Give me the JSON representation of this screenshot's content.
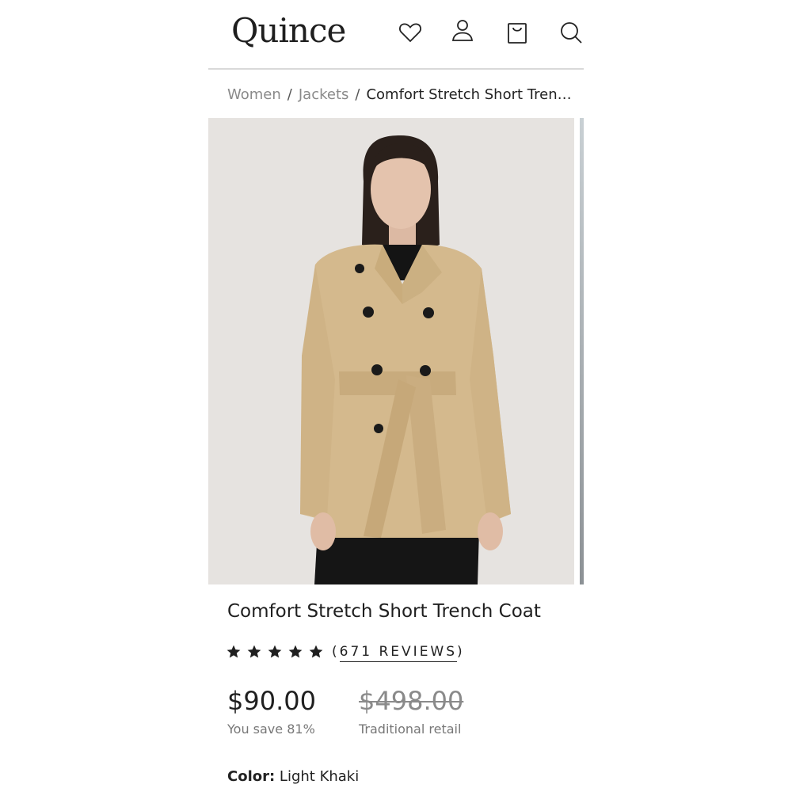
{
  "header": {
    "logo": "Quince",
    "icons": [
      "heart-icon",
      "account-icon",
      "bag-icon",
      "search-icon"
    ]
  },
  "breadcrumb": {
    "items": [
      "Women",
      "Jackets"
    ],
    "current": "Comfort Stretch Short Trench Coat"
  },
  "product": {
    "title": "Comfort Stretch Short Trench Coat",
    "rating": 5,
    "reviews_open": "(",
    "reviews_text": "671 REVIEWS",
    "reviews_close": ")",
    "price": "$90.00",
    "savings": "You save 81%",
    "retail_price": "$498.00",
    "retail_label": "Traditional retail",
    "color_label": "Color:",
    "color_value": "Light Khaki"
  },
  "colors": {
    "text": "#222222",
    "muted": "#8a8a8a",
    "image_bg": "#e6e3e0",
    "coat": "#d4b98d"
  }
}
